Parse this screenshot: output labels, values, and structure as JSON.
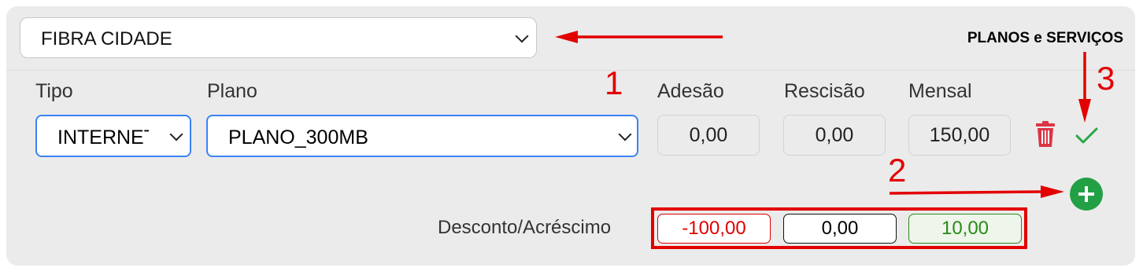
{
  "header": {
    "category_value": "FIBRA CIDADE",
    "section_title": "PLANOS e SERVIÇOS"
  },
  "labels": {
    "tipo": "Tipo",
    "plano": "Plano",
    "adesao": "Adesão",
    "rescisao": "Rescisão",
    "mensal": "Mensal",
    "desconto": "Desconto/Acréscimo"
  },
  "row": {
    "tipo_value": "INTERNET",
    "plano_value": "PLANO_300MB",
    "adesao": "0,00",
    "rescisao": "0,00",
    "mensal": "150,00"
  },
  "discount": {
    "negative": "-100,00",
    "neutral": "0,00",
    "positive": "10,00"
  },
  "annotations": {
    "n1": "1",
    "n2": "2",
    "n3": "3"
  },
  "icons": {
    "delete": "trash-icon",
    "confirm": "check-icon",
    "add": "plus-icon"
  },
  "colors": {
    "accent_blue": "#3b82f6",
    "annotation_red": "#e20000",
    "trash_red": "#dc3545",
    "confirm_green": "#28a745",
    "add_green": "#23a045",
    "discount_neg": "#e00000",
    "discount_pos": "#2a8a1a"
  }
}
